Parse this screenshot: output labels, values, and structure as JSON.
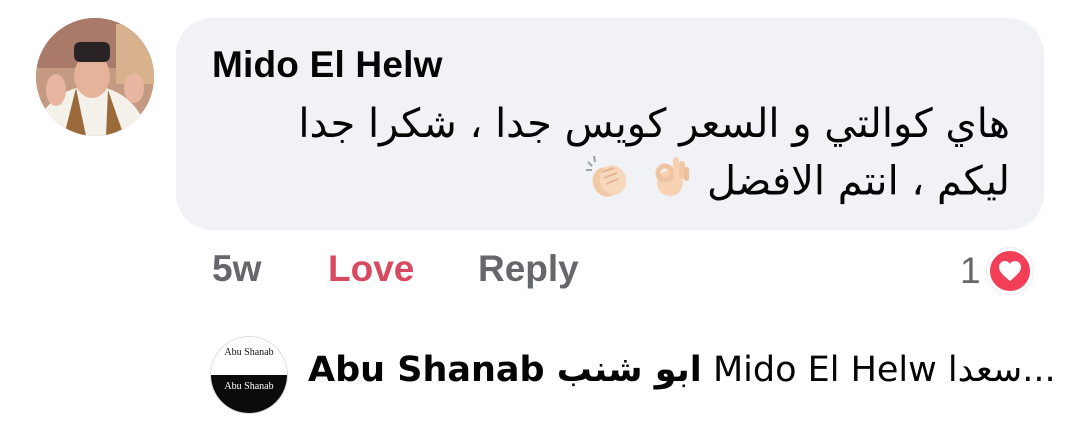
{
  "comment": {
    "author": "Mido El Helw",
    "line1": "هاي كوالتي و السعر كويس جدا ، شكرا جدا",
    "line2": "ليكم ، انتم الافضل",
    "emojis": [
      "ok-hand-icon",
      "clapping-hands-icon"
    ],
    "age": "5w",
    "love_label": "Love",
    "reply_label": "Reply",
    "reaction_count": "1",
    "reaction_type": "heart-icon",
    "reaction_color": "#f33e58",
    "love_color": "#d84a5f"
  },
  "reply_preview": {
    "author": "Abu Shanab ابو شنب",
    "text": "Mido El Helw سعدا...",
    "avatar_text_top": "Abu Shanab",
    "avatar_text_bottom": "Abu Shanab"
  },
  "colors": {
    "bubble_bg": "#f0f2f5",
    "meta_text": "#65676b",
    "primary_text": "#050505"
  }
}
